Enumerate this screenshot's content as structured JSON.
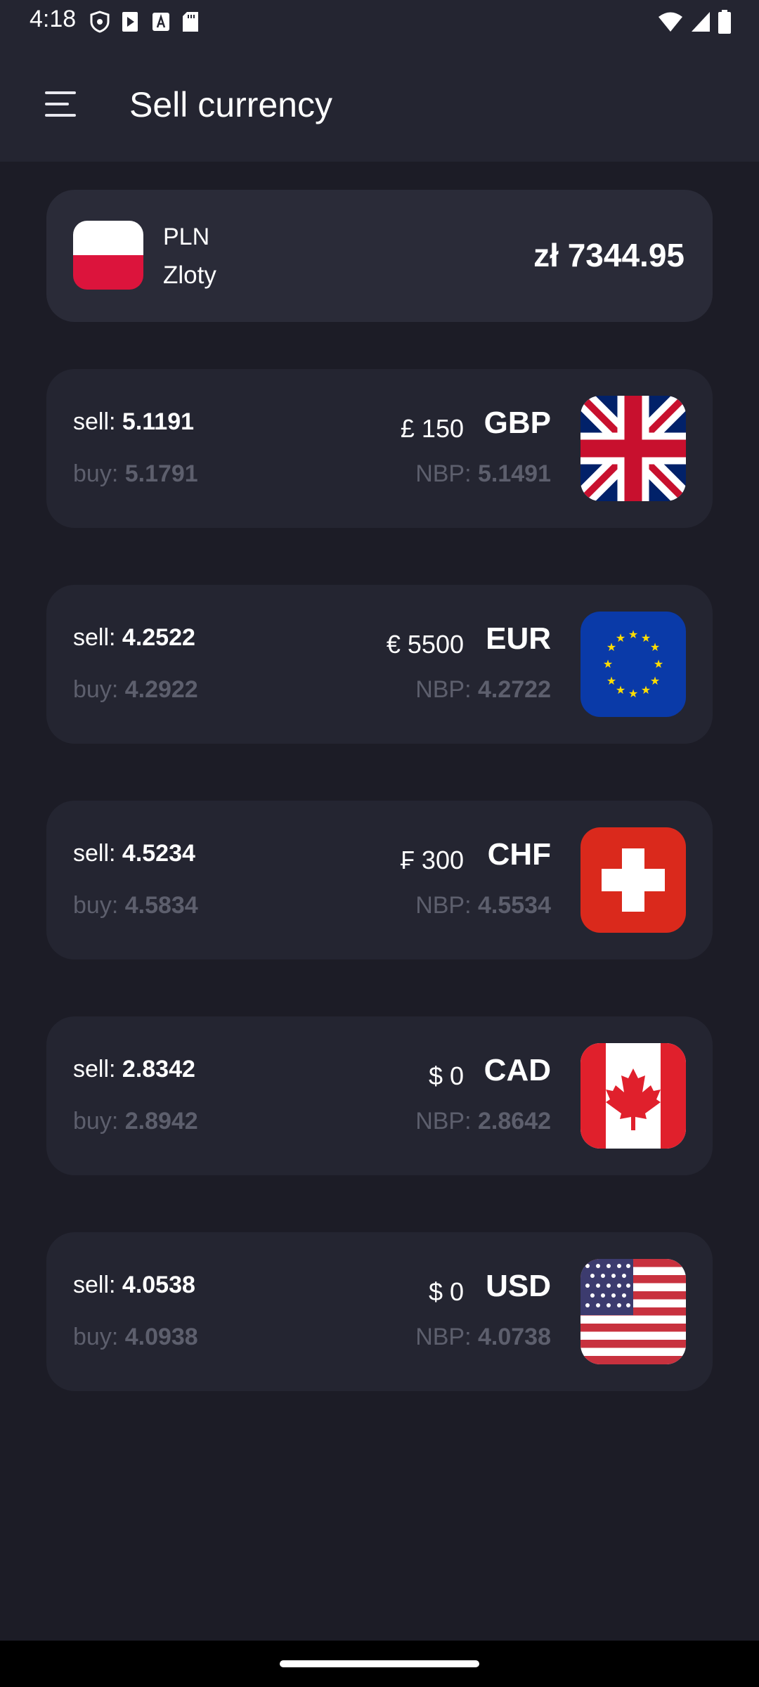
{
  "status_bar": {
    "time": "4:18",
    "left_icons": [
      "shield-icon",
      "play-store-icon",
      "font-icon",
      "sd-card-icon"
    ],
    "right_icons": [
      "wifi-icon",
      "signal-icon",
      "battery-icon"
    ]
  },
  "app_bar": {
    "menu_icon": "menu-icon",
    "title": "Sell currency"
  },
  "base_currency": {
    "code": "PLN",
    "name": "Zloty",
    "amount": "zł 7344.95",
    "flag": "poland-flag"
  },
  "labels": {
    "sell": "sell:",
    "buy": "buy:",
    "nbp": "NBP:"
  },
  "currencies": [
    {
      "code": "GBP",
      "amount": "£ 150",
      "sell": "5.1191",
      "buy": "5.1791",
      "nbp": "5.1491",
      "flag": "uk-flag"
    },
    {
      "code": "EUR",
      "amount": "€ 5500",
      "sell": "4.2522",
      "buy": "4.2922",
      "nbp": "4.2722",
      "flag": "eu-flag"
    },
    {
      "code": "CHF",
      "amount": "₣ 300",
      "sell": "4.5234",
      "buy": "4.5834",
      "nbp": "4.5534",
      "flag": "switzerland-flag"
    },
    {
      "code": "CAD",
      "amount": "$ 0",
      "sell": "2.8342",
      "buy": "2.8942",
      "nbp": "2.8642",
      "flag": "canada-flag"
    },
    {
      "code": "USD",
      "amount": "$ 0",
      "sell": "4.0538",
      "buy": "4.0938",
      "nbp": "4.0738",
      "flag": "usa-flag"
    }
  ],
  "colors": {
    "background": "#1c1c26",
    "bar": "#242531",
    "card": "#242531",
    "muted_text": "#5d5f6d"
  }
}
